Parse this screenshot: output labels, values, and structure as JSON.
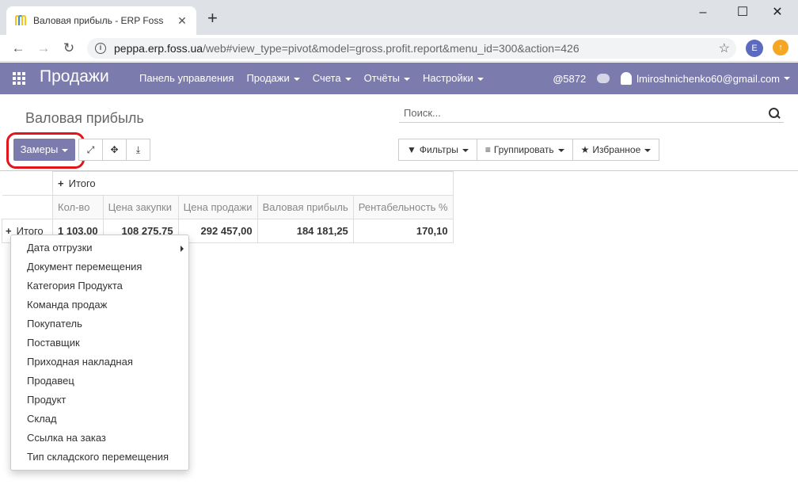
{
  "browser": {
    "tab_title": "Валовая прибыль - ERP Foss",
    "url_host": "peppa.erp.foss.ua",
    "url_path": "/web#view_type=pivot&model=gross.profit.report&menu_id=300&action=426",
    "profile_initial": "E"
  },
  "navbar": {
    "brand": "Продажи",
    "menu": [
      "Панель управления",
      "Продажи",
      "Счета",
      "Отчёты",
      "Настройки"
    ],
    "notifications": "5872",
    "user": "lmiroshnichenko60@gmail.com"
  },
  "control_panel": {
    "breadcrumb": "Валовая прибыль",
    "search_placeholder": "Поиск...",
    "measures_label": "Замеры",
    "filters_label": "Фильтры",
    "groupby_label": "Группировать",
    "favorites_label": "Избранное"
  },
  "pivot": {
    "col_total": "Итого",
    "row_total": "Итого",
    "measures": [
      "Кол-во",
      "Цена закупки",
      "Цена продажи",
      "Валовая прибыль",
      "Рентабельность %"
    ],
    "values": [
      "1 103,00",
      "108 275,75",
      "292 457,00",
      "184 181,25",
      "170,10"
    ]
  },
  "groupby_dropdown": {
    "items": [
      "Дата отгрузки",
      "Документ перемещения",
      "Категория Продукта",
      "Команда продаж",
      "Покупатель",
      "Поставщик",
      "Приходная накладная",
      "Продавец",
      "Продукт",
      "Склад",
      "Ссылка на заказ",
      "Тип складского перемещения"
    ]
  },
  "colors": {
    "primary": "#7c7bad",
    "highlight": "#e2151c"
  }
}
